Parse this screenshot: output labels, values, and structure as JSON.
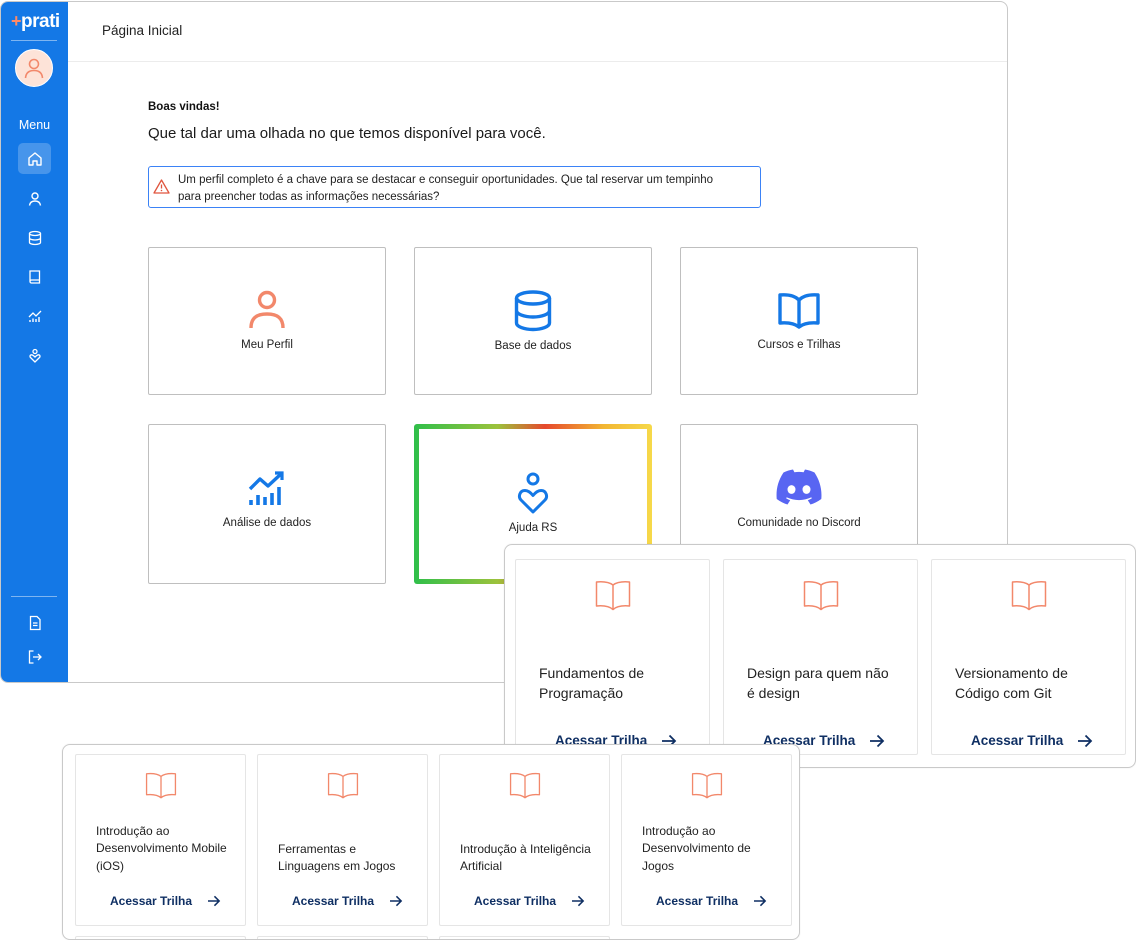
{
  "sidebar": {
    "logo_text": "prati",
    "menu_label": "Menu",
    "nav_items": [
      "home-icon",
      "user-icon",
      "database-icon",
      "book-icon",
      "analytics-icon",
      "heart-hand-icon"
    ],
    "bottom_items": [
      "document-icon",
      "logout-icon"
    ],
    "accent": "#1478e6"
  },
  "header": {
    "title": "Página Inicial"
  },
  "welcome": {
    "greeting": "Boas vindas!",
    "subtitle": "Que tal dar uma olhada no que temos disponível para você."
  },
  "alert": {
    "text": "Um perfil completo é a chave para se destacar e conseguir oportunidades. Que tal reservar um tempinho para preencher todas as informações necessárias?"
  },
  "cards": [
    {
      "label": "Meu Perfil",
      "icon": "user-icon"
    },
    {
      "label": "Base de dados",
      "icon": "database-icon"
    },
    {
      "label": "Cursos e Trilhas",
      "icon": "book-open-icon"
    },
    {
      "label": "Análise de dados",
      "icon": "analytics-icon"
    },
    {
      "label": "Ajuda RS",
      "icon": "heart-hand-icon"
    },
    {
      "label": "Comunidade no Discord",
      "icon": "discord-icon"
    }
  ],
  "trails_panel_1": [
    {
      "title": "Fundamentos de Programação",
      "link": "Acessar Trilha"
    },
    {
      "title": "Design para quem não é design",
      "link": "Acessar Trilha"
    },
    {
      "title": "Versionamento de Código com Git",
      "link": "Acessar Trilha"
    }
  ],
  "trails_panel_2": [
    {
      "title": "Introdução ao Desenvolvimento Mobile (iOS)",
      "link": "Acessar Trilha"
    },
    {
      "title": "Ferramentas e Linguagens em Jogos",
      "link": "Acessar Trilha"
    },
    {
      "title": "Introdução à Inteligência Artificial",
      "link": "Acessar Trilha"
    },
    {
      "title": "Introdução ao Desenvolvimento de Jogos",
      "link": "Acessar Trilha"
    }
  ],
  "colors": {
    "primary": "#1478e6",
    "coral": "#f2886b",
    "discord": "#5865f2",
    "link": "#0f2f63"
  }
}
